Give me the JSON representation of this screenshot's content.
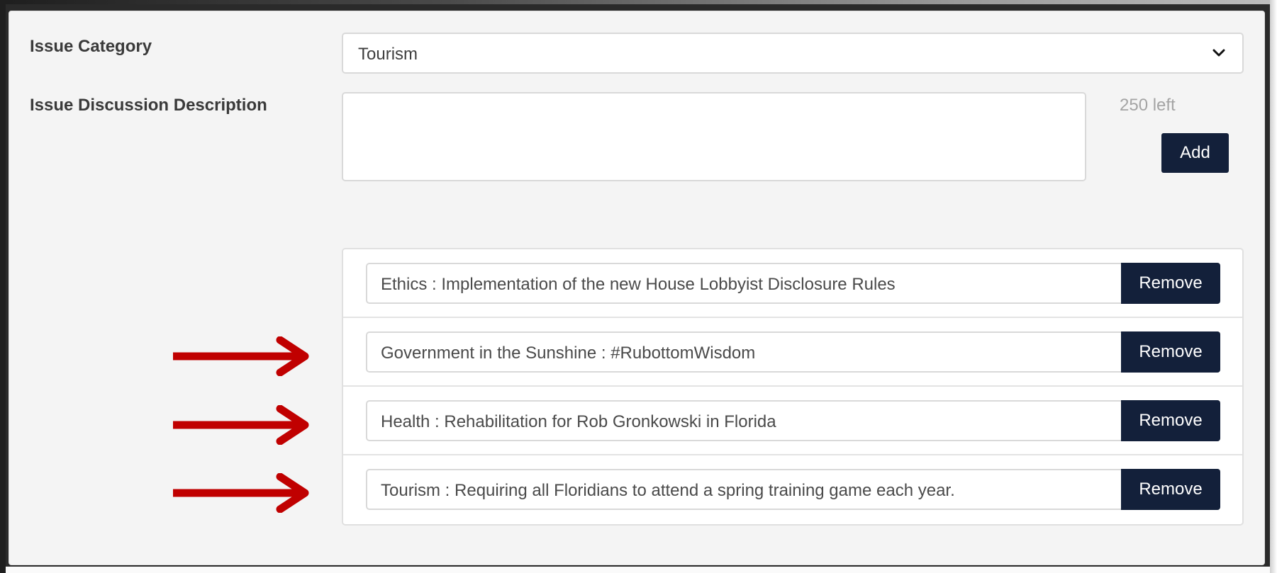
{
  "form": {
    "category_label": "Issue Category",
    "category_value": "Tourism",
    "description_label": "Issue Discussion Description",
    "description_value": "",
    "chars_left": "250 left",
    "add_label": "Add"
  },
  "issues": [
    {
      "text": "Ethics : Implementation of the new House Lobbyist Disclosure Rules",
      "remove_label": "Remove",
      "arrow": false
    },
    {
      "text": "Government in the Sunshine : #RubottomWisdom",
      "remove_label": "Remove",
      "arrow": true
    },
    {
      "text": "Health : Rehabilitation for Rob Gronkowski in Florida",
      "remove_label": "Remove",
      "arrow": true
    },
    {
      "text": "Tourism : Requiring all Floridians to attend a spring training game each year.",
      "remove_label": "Remove",
      "arrow": true
    }
  ],
  "colors": {
    "button_bg": "#13203a",
    "arrow": "#c00000",
    "panel_bg": "#f4f4f4"
  },
  "icons": {
    "dropdown": "chevron-down-icon",
    "pointer": "red-arrow-icon"
  }
}
